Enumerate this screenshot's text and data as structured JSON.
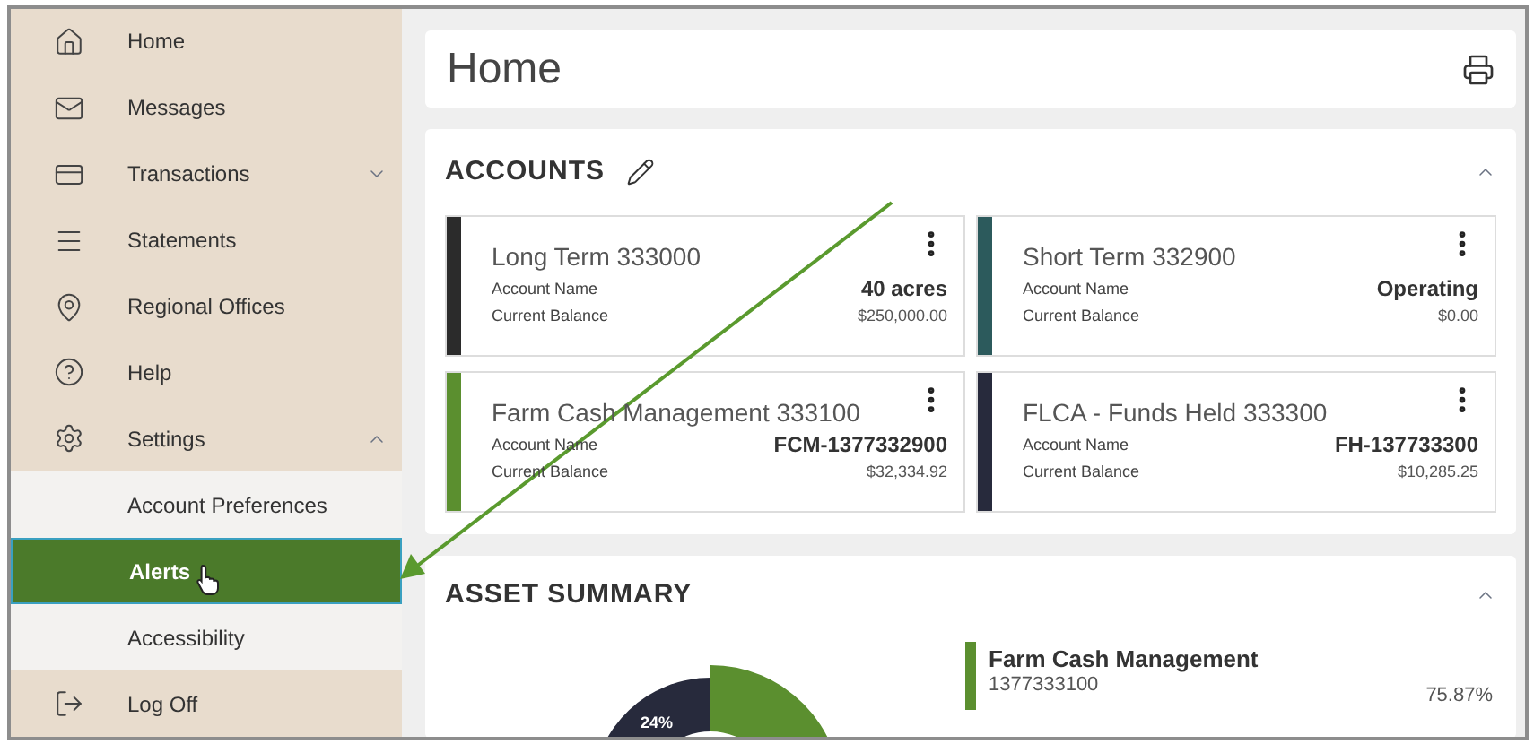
{
  "sidebar": {
    "items": [
      {
        "label": "Home"
      },
      {
        "label": "Messages"
      },
      {
        "label": "Transactions",
        "expanded": false
      },
      {
        "label": "Statements"
      },
      {
        "label": "Regional Offices"
      },
      {
        "label": "Help"
      },
      {
        "label": "Settings",
        "expanded": true,
        "children": [
          {
            "label": "Account Preferences",
            "selected": false
          },
          {
            "label": "Alerts",
            "selected": true
          },
          {
            "label": "Accessibility",
            "selected": false
          }
        ]
      },
      {
        "label": "Log Off"
      }
    ]
  },
  "page": {
    "title": "Home"
  },
  "accounts": {
    "title": "ACCOUNTS",
    "expanded": true,
    "items": [
      {
        "name": "Long Term 333000",
        "color": "#2b2b2b",
        "name_label": "Account Name",
        "balance_label": "Current Balance",
        "account_name": "40 acres",
        "balance": "$250,000.00"
      },
      {
        "name": "Short Term 332900",
        "color": "#2c5a5c",
        "name_label": "Account Name",
        "balance_label": "Current Balance",
        "account_name": "Operating",
        "balance": "$0.00"
      },
      {
        "name": "Farm Cash Management 333100",
        "color": "#5b8f2f",
        "name_label": "Account Name",
        "balance_label": "Current Balance",
        "account_name": "FCM-1377332900",
        "balance": "$32,334.92"
      },
      {
        "name": "FLCA - Funds Held 333300",
        "color": "#272a3c",
        "name_label": "Account Name",
        "balance_label": "Current Balance",
        "account_name": "FH-137733300",
        "balance": "$10,285.25"
      }
    ]
  },
  "asset_summary": {
    "title": "ASSET SUMMARY",
    "expanded": true,
    "slice_label": "24%",
    "legend": [
      {
        "name": "Farm Cash Management",
        "number": "1377333100",
        "percent": "75.87%",
        "color": "#5b8f2f"
      }
    ]
  }
}
